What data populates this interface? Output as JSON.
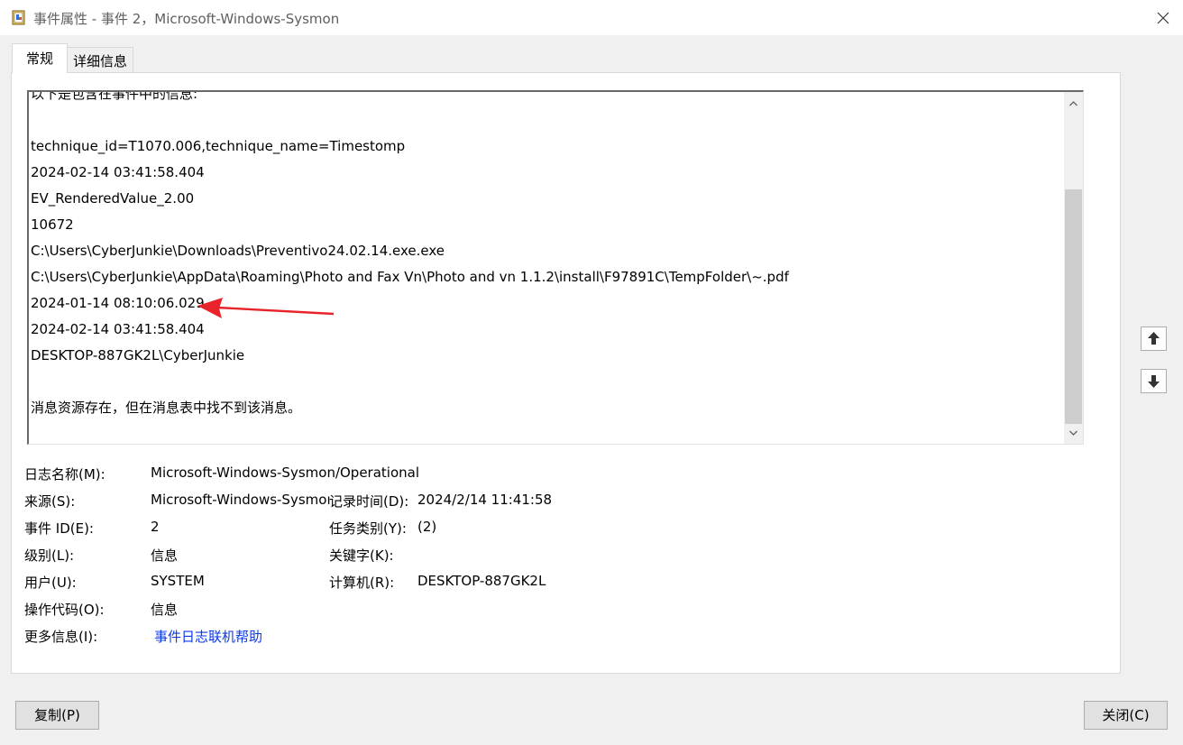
{
  "window": {
    "title": "事件属性 - 事件 2，Microsoft-Windows-Sysmon",
    "app_icon": "event-viewer-icon",
    "close_icon": "close-icon"
  },
  "tabs": [
    {
      "label": "常规",
      "selected": true
    },
    {
      "label": "详细信息",
      "selected": false
    }
  ],
  "description": {
    "lines": [
      "以下是包含在事件中的信息:",
      "",
      "technique_id=T1070.006,technique_name=Timestomp",
      "2024-02-14 03:41:58.404",
      "EV_RenderedValue_2.00",
      "10672",
      "C:\\Users\\CyberJunkie\\Downloads\\Preventivo24.02.14.exe.exe",
      "C:\\Users\\CyberJunkie\\AppData\\Roaming\\Photo and Fax Vn\\Photo and vn 1.1.2\\install\\F97891C\\TempFolder\\~.pdf",
      "2024-01-14 08:10:06.029",
      "2024-02-14 03:41:58.404",
      "DESKTOP-887GK2L\\CyberJunkie",
      "",
      "消息资源存在，但在消息表中找不到该消息。"
    ],
    "annotation_color": "#e8232a"
  },
  "properties": {
    "log_name_label": "日志名称(M):",
    "log_name_value": "Microsoft-Windows-Sysmon/Operational",
    "source_label": "来源(S):",
    "source_value": "Microsoft-Windows-Sysmoı",
    "logged_label": "记录时间(D):",
    "logged_value": "2024/2/14 11:41:58",
    "event_id_label": "事件 ID(E):",
    "event_id_value": "2",
    "task_label": "任务类别(Y):",
    "task_value": "(2)",
    "level_label": "级别(L):",
    "level_value": "信息",
    "keywords_label": "关键字(K):",
    "user_label": "用户(U):",
    "user_value": "SYSTEM",
    "computer_label": "计算机(R):",
    "computer_value": "DESKTOP-887GK2L",
    "opcode_label": "操作代码(O):",
    "opcode_value": "信息",
    "more_info_label": "更多信息(I):",
    "more_info_link": "事件日志联机帮助",
    "link_color": "#0b39e4"
  },
  "nav": {
    "up_icon": "arrow-up-icon",
    "down_icon": "arrow-down-icon"
  },
  "buttons": {
    "copy": "复制(P)",
    "close": "关闭(C)"
  }
}
